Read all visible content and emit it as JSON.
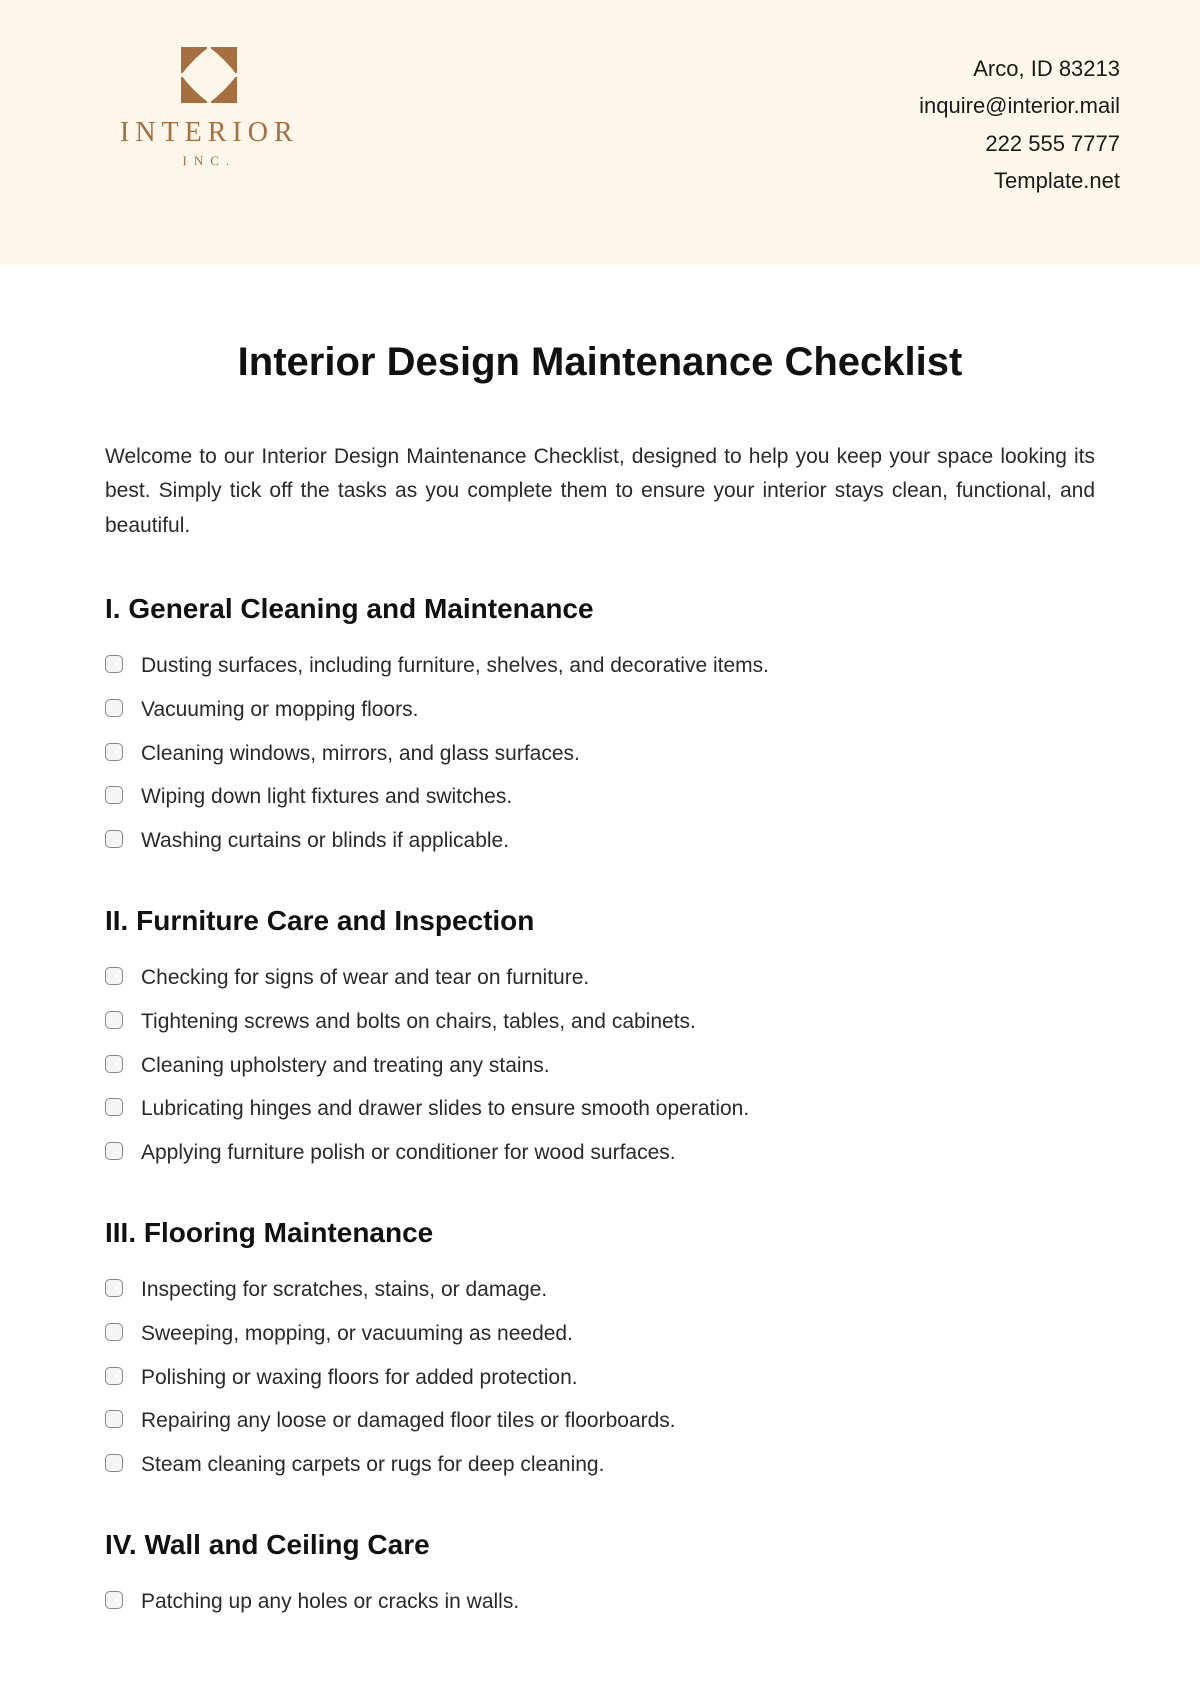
{
  "header": {
    "logo": {
      "main": "INTERIOR",
      "sub": "INC."
    },
    "contact": {
      "address": "Arco, ID 83213",
      "email": "inquire@interior.mail",
      "phone": "222 555 7777",
      "website": "Template.net"
    }
  },
  "title": "Interior Design Maintenance Checklist",
  "intro": "Welcome to our Interior Design Maintenance Checklist, designed to help you keep your space looking its best. Simply tick off the tasks as you complete them to ensure your interior stays clean, functional, and beautiful.",
  "sections": [
    {
      "heading": "I. General Cleaning and Maintenance",
      "items": [
        "Dusting surfaces, including furniture, shelves, and decorative items.",
        "Vacuuming or mopping floors.",
        "Cleaning windows, mirrors, and glass surfaces.",
        "Wiping down light fixtures and switches.",
        "Washing curtains or blinds if applicable."
      ]
    },
    {
      "heading": "II. Furniture Care and Inspection",
      "items": [
        "Checking for signs of wear and tear on furniture.",
        "Tightening screws and bolts on chairs, tables, and cabinets.",
        "Cleaning upholstery and treating any stains.",
        "Lubricating hinges and drawer slides to ensure smooth operation.",
        "Applying furniture polish or conditioner for wood surfaces."
      ]
    },
    {
      "heading": "III. Flooring Maintenance",
      "items": [
        "Inspecting for scratches, stains, or damage.",
        "Sweeping, mopping, or vacuuming as needed.",
        "Polishing or waxing floors for added protection.",
        "Repairing any loose or damaged floor tiles or floorboards.",
        "Steam cleaning carpets or rugs for deep cleaning."
      ]
    },
    {
      "heading": "IV. Wall and Ceiling Care",
      "items": [
        "Patching up any holes or cracks in walls."
      ]
    }
  ]
}
